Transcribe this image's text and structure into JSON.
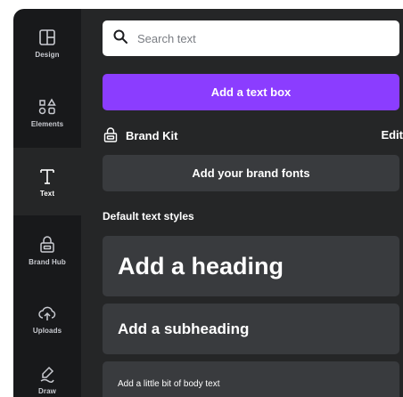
{
  "sidebar": {
    "items": [
      {
        "label": "Design",
        "icon": "design-icon"
      },
      {
        "label": "Elements",
        "icon": "elements-icon"
      },
      {
        "label": "Text",
        "icon": "text-icon",
        "active": true
      },
      {
        "label": "Brand Hub",
        "icon": "brand-hub-icon"
      },
      {
        "label": "Uploads",
        "icon": "uploads-icon"
      },
      {
        "label": "Draw",
        "icon": "draw-icon"
      }
    ]
  },
  "panel": {
    "search": {
      "placeholder": "Search text",
      "value": ""
    },
    "add_text_box_label": "Add a text box",
    "brand_kit": {
      "label": "Brand Kit",
      "edit_label": "Edit"
    },
    "brand_fonts_label": "Add your brand fonts",
    "default_styles_title": "Default text styles",
    "styles": {
      "heading": "Add a heading",
      "subheading": "Add a subheading",
      "body": "Add a little bit of body text"
    }
  },
  "colors": {
    "accent": "#8b3dff",
    "rail_bg": "#18191b",
    "panel_bg": "#252627",
    "card_bg": "#393b3e"
  }
}
